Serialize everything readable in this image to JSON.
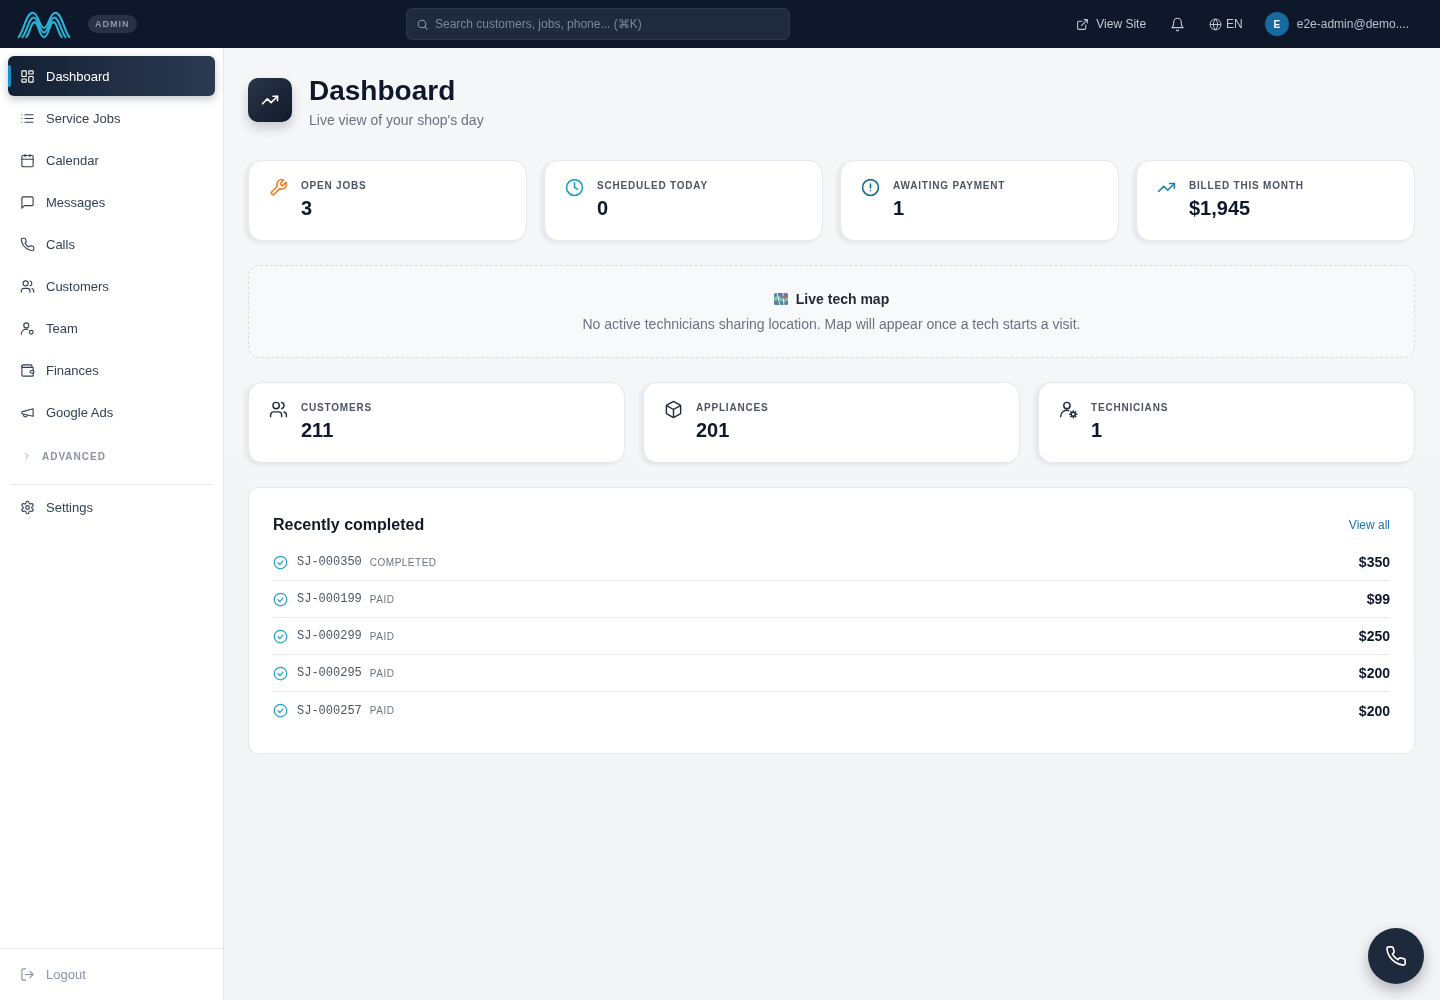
{
  "topbar": {
    "badge": "ADMIN",
    "search": {
      "placeholder": "Search customers, jobs, phone... (⌘K)"
    },
    "view_site": "View Site",
    "language": "EN",
    "user": {
      "initial": "E",
      "email": "e2e-admin@demo...."
    }
  },
  "sidebar": {
    "items": [
      {
        "label": "Dashboard",
        "selected": true
      },
      {
        "label": "Service Jobs",
        "selected": false
      },
      {
        "label": "Calendar",
        "selected": false
      },
      {
        "label": "Messages",
        "selected": false
      },
      {
        "label": "Calls",
        "selected": false
      },
      {
        "label": "Customers",
        "selected": false
      },
      {
        "label": "Team",
        "selected": false
      },
      {
        "label": "Finances",
        "selected": false
      },
      {
        "label": "Google Ads",
        "selected": false
      }
    ],
    "section": {
      "label": "ADVANCED",
      "expanded": false
    },
    "footer_items": [
      {
        "label": "Settings",
        "selected": false
      }
    ],
    "logout": "Logout"
  },
  "header": {
    "title": "Dashboard",
    "subtitle": "Live view of your shop's day"
  },
  "stats": [
    {
      "label": "OPEN JOBS",
      "value": "3",
      "color": "#e8822a"
    },
    {
      "label": "SCHEDULED TODAY",
      "value": "0",
      "color": "#1e9cc8"
    },
    {
      "label": "AWAITING PAYMENT",
      "value": "1",
      "color": "#166b9c"
    },
    {
      "label": "BILLED THIS MONTH",
      "value": "$1,945",
      "color": "#1a7fb4"
    }
  ],
  "map": {
    "title": "Live tech map",
    "message": "No active technicians sharing location. Map will appear once a tech starts a visit."
  },
  "totals": [
    {
      "label": "CUSTOMERS",
      "value": "211"
    },
    {
      "label": "APPLIANCES",
      "value": "201"
    },
    {
      "label": "TECHNICIANS",
      "value": "1"
    }
  ],
  "recent": {
    "title": "Recently completed",
    "link": "View all",
    "rows": [
      {
        "job": "SJ-000350",
        "status": "COMPLETED",
        "amount": "$350"
      },
      {
        "job": "SJ-000199",
        "status": "PAID",
        "amount": "$99"
      },
      {
        "job": "SJ-000299",
        "status": "PAID",
        "amount": "$250"
      },
      {
        "job": "SJ-000295",
        "status": "PAID",
        "amount": "$200"
      },
      {
        "job": "SJ-000257",
        "status": "PAID",
        "amount": "$200"
      }
    ]
  }
}
